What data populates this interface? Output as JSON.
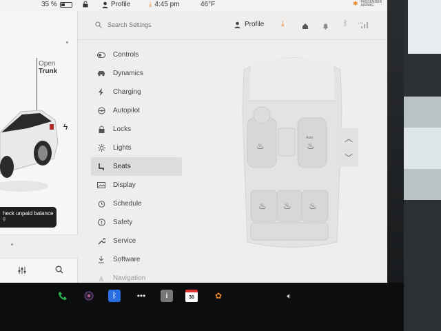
{
  "status": {
    "battery": "35 %",
    "profile_label": "Profile",
    "time": "4:45 pm",
    "temperature": "46°F",
    "airbag_text": "PASSENGER AIRBAG"
  },
  "left_panel": {
    "open_label": "Open",
    "trunk_label": "Trunk",
    "toast": "heck unpaid balance",
    "toast_sub": "g"
  },
  "topbar": {
    "search_placeholder": "Search Settings",
    "profile_label": "Profile"
  },
  "menu": [
    {
      "label": "Controls",
      "icon": "toggle-icon"
    },
    {
      "label": "Dynamics",
      "icon": "car-icon"
    },
    {
      "label": "Charging",
      "icon": "bolt-icon"
    },
    {
      "label": "Autopilot",
      "icon": "steering-wheel-icon"
    },
    {
      "label": "Locks",
      "icon": "lock-icon"
    },
    {
      "label": "Lights",
      "icon": "sun-icon"
    },
    {
      "label": "Seats",
      "icon": "seat-icon",
      "active": true
    },
    {
      "label": "Display",
      "icon": "display-icon"
    },
    {
      "label": "Schedule",
      "icon": "clock-icon"
    },
    {
      "label": "Safety",
      "icon": "info-icon"
    },
    {
      "label": "Service",
      "icon": "wrench-icon"
    },
    {
      "label": "Software",
      "icon": "download-icon"
    },
    {
      "label": "Navigation",
      "icon": "navigation-icon"
    }
  ],
  "seat_heater_label": "Auto",
  "dock": {
    "calendar_day": "30"
  },
  "colors": {
    "accent_orange": "#e8862c",
    "phone_green": "#2fb24a",
    "bluetooth_blue": "#2a6fe0"
  }
}
